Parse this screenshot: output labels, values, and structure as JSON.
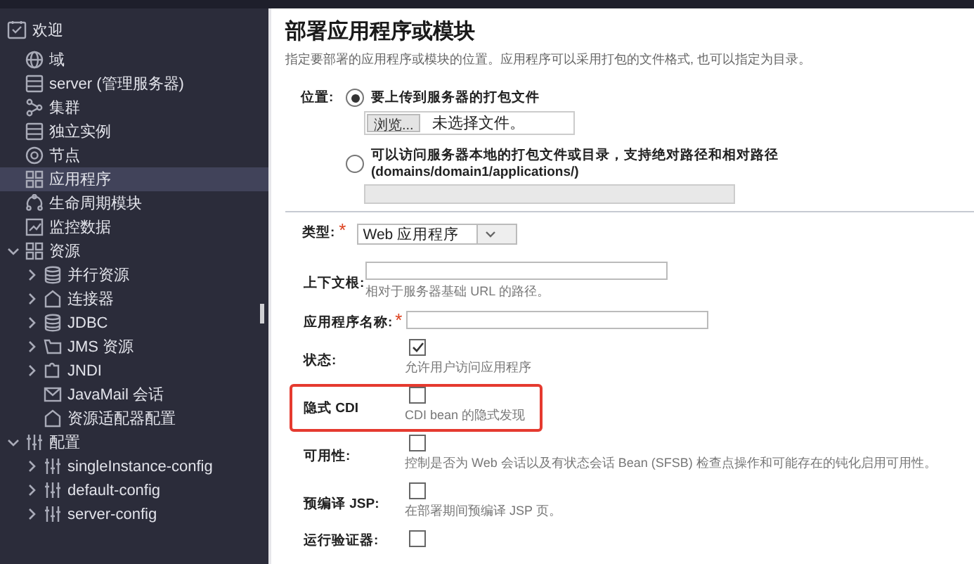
{
  "sidebar": {
    "home": {
      "label": "欢迎"
    },
    "items": [
      {
        "label": "域",
        "kind": "leaf",
        "selected": false
      },
      {
        "label": "server (管理服务器)",
        "kind": "leaf",
        "selected": false
      },
      {
        "label": "集群",
        "kind": "leaf",
        "selected": false
      },
      {
        "label": "独立实例",
        "kind": "leaf",
        "selected": false
      },
      {
        "label": "节点",
        "kind": "leaf",
        "selected": false
      },
      {
        "label": "应用程序",
        "kind": "leaf",
        "selected": true
      },
      {
        "label": "生命周期模块",
        "kind": "leaf",
        "selected": false
      },
      {
        "label": "监控数据",
        "kind": "leaf",
        "selected": false
      },
      {
        "label": "资源",
        "kind": "folder",
        "expanded": true,
        "selected": false,
        "children": [
          {
            "label": "并行资源",
            "kind": "folder",
            "expanded": false,
            "selected": false
          },
          {
            "label": "连接器",
            "kind": "folder",
            "expanded": false,
            "selected": false
          },
          {
            "label": "JDBC",
            "kind": "folder",
            "expanded": false,
            "selected": false
          },
          {
            "label": "JMS 资源",
            "kind": "folder",
            "expanded": false,
            "selected": false
          },
          {
            "label": "JNDI",
            "kind": "folder",
            "expanded": false,
            "selected": false
          },
          {
            "label": "JavaMail 会话",
            "kind": "leaf",
            "selected": false
          },
          {
            "label": "资源适配器配置",
            "kind": "leaf",
            "selected": false
          }
        ]
      },
      {
        "label": "配置",
        "kind": "folder",
        "expanded": true,
        "selected": false,
        "children": [
          {
            "label": "singleInstance-config",
            "kind": "folder",
            "expanded": false,
            "selected": false
          },
          {
            "label": "default-config",
            "kind": "folder",
            "expanded": false,
            "selected": false
          },
          {
            "label": "server-config",
            "kind": "folder",
            "expanded": false,
            "selected": false
          }
        ]
      }
    ]
  },
  "page": {
    "title": "部署应用程序或模块",
    "description": "指定要部署的应用程序或模块的位置。应用程序可以采用打包的文件格式, 也可以指定为目录。"
  },
  "location": {
    "label": "位置:",
    "options": [
      {
        "kind": "file",
        "label": "要上传到服务器的打包文件",
        "selected": true,
        "button": "浏览...",
        "value": "未选择文件。"
      },
      {
        "kind": "path",
        "label": "可以访问服务器本地的打包文件或目录，支持绝对路径和相对路径 (domains/domain1/applications/)",
        "selected": false
      }
    ]
  },
  "type": {
    "label": "类型:",
    "required_mark": "*",
    "value": "Web 应用程序"
  },
  "fields": [
    {
      "kind": "text",
      "label": "上下文根:",
      "help": "相对于服务器基础 URL 的路径。",
      "highlighted": false
    },
    {
      "kind": "text",
      "label": "应用程序名称:",
      "required_mark": "*",
      "highlighted": false
    },
    {
      "kind": "checkbox",
      "label": "状态:",
      "checked": true,
      "help": "允许用户访问应用程序",
      "highlighted": false
    },
    {
      "kind": "checkbox",
      "label": "隐式 CDI",
      "checked": false,
      "help": "CDI bean 的隐式发现",
      "highlighted": true
    },
    {
      "kind": "checkbox",
      "label": "可用性:",
      "checked": false,
      "help": "控制是否为 Web 会话以及有状态会话 Bean (SFSB) 检查点操作和可能存在的钝化启用可用性。",
      "highlighted": false
    },
    {
      "kind": "checkbox",
      "label": "预编译 JSP:",
      "checked": false,
      "help": "在部署期间预编译 JSP 页。",
      "highlighted": false
    },
    {
      "kind": "checkbox",
      "label": "运行验证器:",
      "checked": false,
      "highlighted": false
    }
  ]
}
